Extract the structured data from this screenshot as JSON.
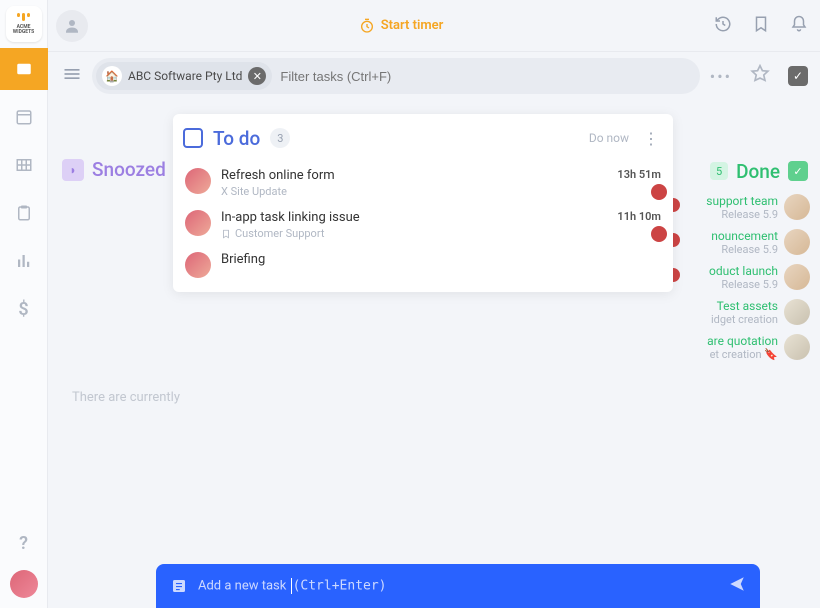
{
  "logo_text": "ACME WIDGETS",
  "topbar": {
    "start_timer": "Start timer"
  },
  "filter": {
    "chip_label": "ABC Software Pty Ltd",
    "placeholder": "Filter tasks (Ctrl+F)"
  },
  "columns": {
    "snoozed": {
      "label": "Snoozed",
      "empty_text": "There are currently"
    },
    "todo": {
      "label": "To do",
      "count": "3",
      "do_now": "Do now",
      "tasks": [
        {
          "title": "Refresh online form",
          "sub": "X Site Update",
          "time": "13h 51m"
        },
        {
          "title": "In-app task linking issue",
          "sub": "Customer Support",
          "time": "11h 10m"
        },
        {
          "title": "Briefing",
          "sub": "",
          "time": ""
        }
      ]
    },
    "done": {
      "label": "Done",
      "count": "5",
      "items": [
        {
          "title": "support team",
          "sub": "Release 5.9"
        },
        {
          "title": "nouncement",
          "sub": "Release 5.9"
        },
        {
          "title": "oduct launch",
          "sub": "Release 5.9"
        },
        {
          "title": "Test assets",
          "sub": "idget creation"
        },
        {
          "title": "are quotation",
          "sub": "et creation  🔖"
        }
      ]
    }
  },
  "add_task": {
    "label": "Add a new task ",
    "shortcut": "(Ctrl+Enter)"
  }
}
